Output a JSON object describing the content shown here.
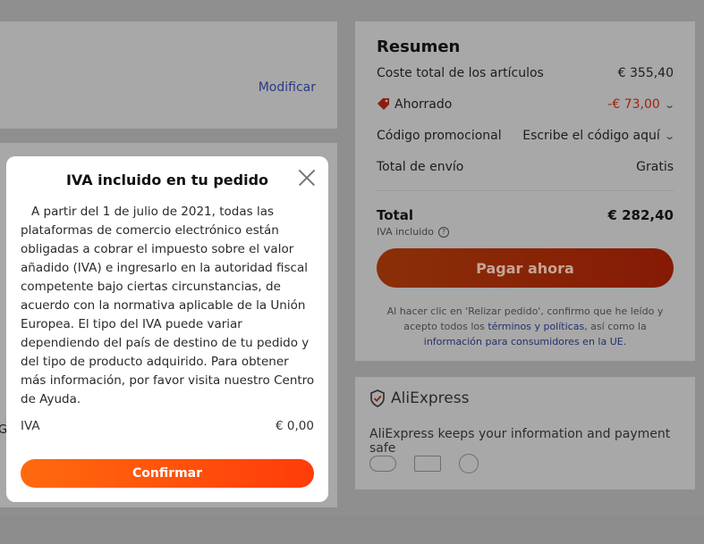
{
  "background": {
    "modify_link": "Modificar",
    "stray_letter": "G"
  },
  "summary": {
    "title": "Resumen",
    "rows": {
      "items_total_label": "Coste total de los artículos",
      "items_total_value": "€ 355,40",
      "saved_label": "Ahorrado",
      "saved_value": "-€ 73,00",
      "promo_label": "Código promocional",
      "promo_value": "Escribe el código aquí",
      "shipping_label": "Total de envío",
      "shipping_value": "Gratis"
    },
    "total_label": "Total",
    "total_value": "€ 282,40",
    "vat_included": "IVA incluido",
    "pay_button": "Pagar ahora",
    "legal": {
      "part1": "Al hacer clic en 'Relizar pedido', confirmo que he leído y acepto todos los ",
      "link1": "términos y políticas",
      "part2": ", así como la ",
      "link2": "información para consumidores en la UE."
    }
  },
  "trust": {
    "brand": "AliExpress",
    "text": "AliExpress keeps your information and payment safe"
  },
  "modal": {
    "title": "IVA incluido en tu pedido",
    "body": "A partir del 1 de julio de 2021, todas las plataformas de comercio electrónico están obligadas a cobrar el impuesto sobre el valor añadido (IVA) e ingresarlo en la autoridad fiscal competente bajo ciertas circunstancias, de acuerdo con la normativa aplicable de la Unión Europea. El tipo del IVA puede variar dependiendo del país de destino de tu pedido y del tipo de producto adquirido. Para obtener más información, por favor visita nuestro Centro de Ayuda.",
    "iva_label": "IVA",
    "iva_value": "€ 0,00",
    "confirm_button": "Confirmar"
  },
  "colors": {
    "overlay": "#8f8f8f",
    "accent": "#ff4f0c",
    "saved": "#a1240e"
  }
}
